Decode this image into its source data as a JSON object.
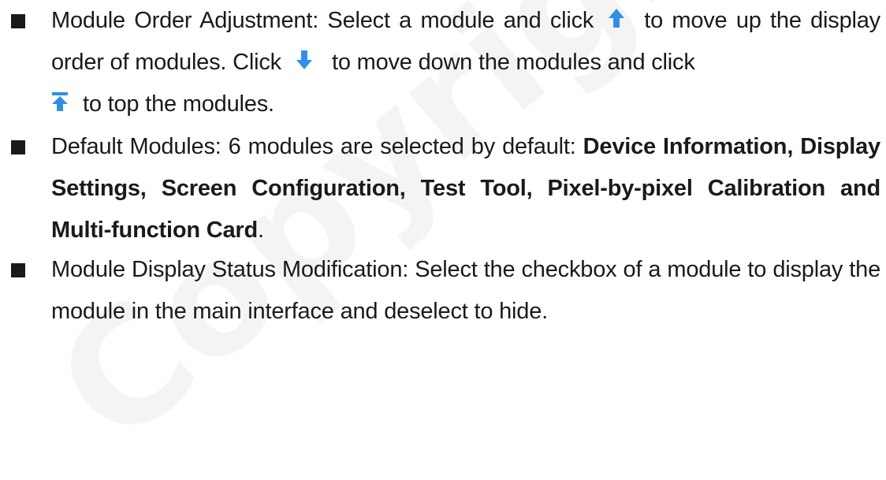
{
  "watermark": "Copyright ©",
  "accent_color": "#2f8fe6",
  "items": [
    {
      "p1": "Module Order Adjustment: Select a module and click",
      "p2": "to move up the display order of modules. Click",
      "p3": "to move down the modules and click",
      "p4": "to top the modules.",
      "icons": [
        "arrow-up-icon",
        "arrow-down-icon",
        "arrow-to-top-icon"
      ]
    },
    {
      "lead": "Default Modules: 6 modules are selected by default:",
      "modules": "Device Information, Display Settings, Screen Configuration, Test Tool, Pixel-by-pixel Calibration and Multi-function Card",
      "end": "."
    },
    {
      "text": "Module Display Status Modification: Select the checkbox of a module to display the module in the main interface and deselect to hide."
    }
  ]
}
